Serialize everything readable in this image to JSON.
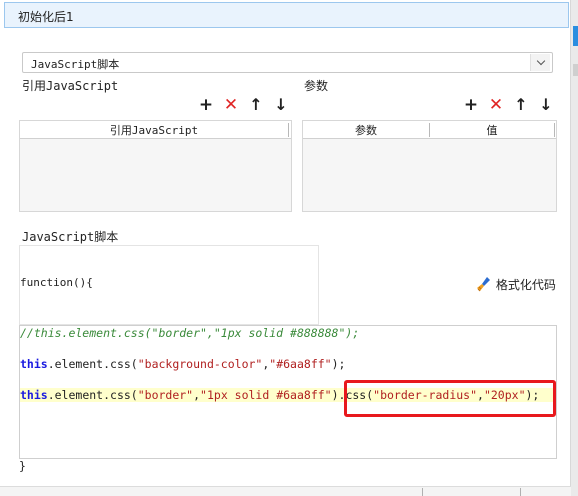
{
  "dialog": {
    "title": "初始化后1"
  },
  "script_type": {
    "selected": "JavaScript脚本"
  },
  "ref_section": {
    "label": "引用JavaScript",
    "columns": [
      "引用JavaScript"
    ]
  },
  "param_section": {
    "label": "参数",
    "columns": [
      "参数",
      "值"
    ]
  },
  "toolbar_icons": [
    "plus-icon",
    "delete-icon",
    "arrow-up-icon",
    "arrow-down-icon"
  ],
  "script_section": {
    "label": "JavaScript脚本",
    "function_header": "function(){",
    "format_label": "格式化代码",
    "closing_brace": "}"
  },
  "code": {
    "line1": "//this.element.css(\"border\",\"1px solid #888888\");",
    "line2_kw": "this",
    "line2_a": ".element.css(",
    "line2_s1": "\"background-color\"",
    "line2_comma": ",",
    "line2_s2": "\"#6aa8ff\"",
    "line2_end": ");",
    "line3_kw": "this",
    "line3_a": ".element.css(",
    "line3_s1": "\"border\"",
    "line3_comma": ",",
    "line3_s2": "\"1px solid #6aa8ff\"",
    "line3_mid": ").css(",
    "line3_s3": "\"border-radius\"",
    "line3_comma2": ",",
    "line3_s4": "\"20px\"",
    "line3_end": ");"
  },
  "colors": {
    "highlight_box": "#e8181d",
    "delete": "#e02424",
    "accent": "#2b8ee0"
  }
}
